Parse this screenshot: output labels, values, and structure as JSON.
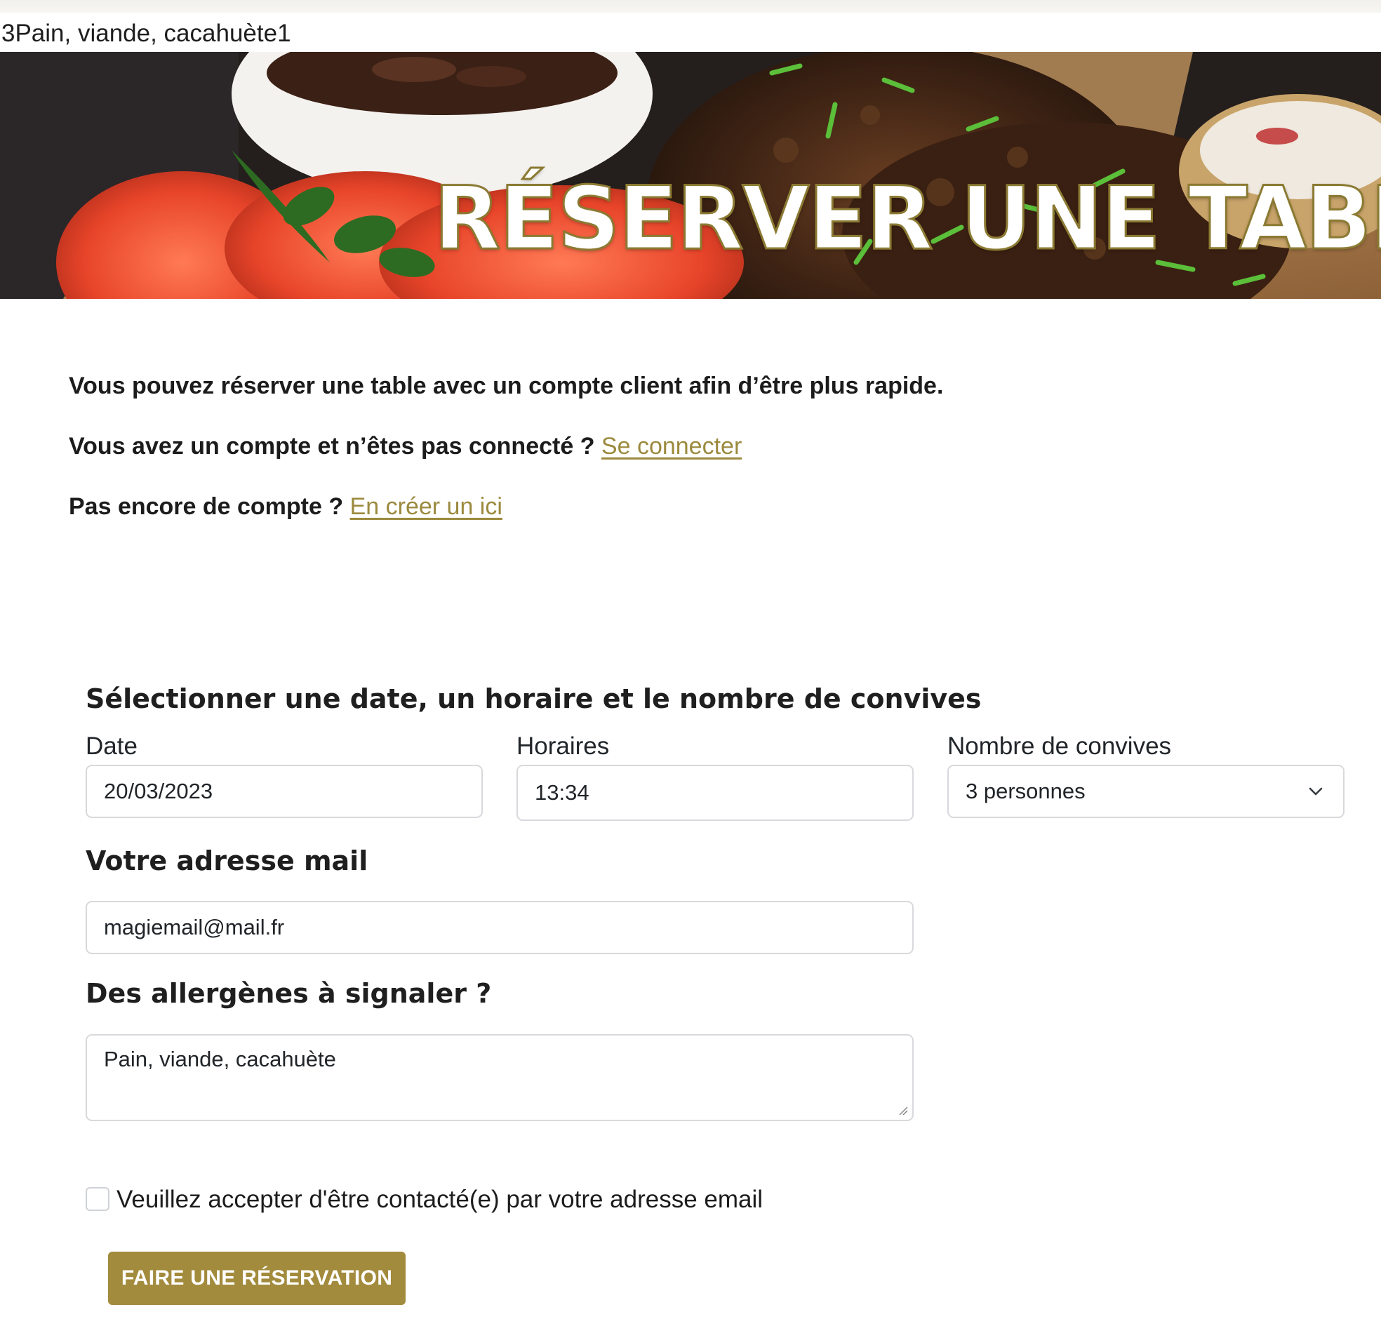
{
  "debug_output": "3Pain, viande, cacahuète1",
  "hero": {
    "title": "RÉSERVER UNE TABLE"
  },
  "intro": {
    "line1": "Vous pouvez réserver une table avec un compte client afin d’être plus rapide.",
    "line2_text": "Vous avez un compte et n’êtes pas connecté ?",
    "line2_link": "Se connecter",
    "line3_text": "Pas encore de compte ?",
    "line3_link": "En créer un ici"
  },
  "booking": {
    "heading": "Sélectionner une date, un horaire et le nombre de convives",
    "date_label": "Date",
    "date_value": "20/03/2023",
    "time_label": "Horaires",
    "time_value": "13:34",
    "guests_label": "Nombre de convives",
    "guests_selected": "3 personnes"
  },
  "email": {
    "heading": "Votre adresse mail",
    "value": "magiemail@mail.fr"
  },
  "allergens": {
    "heading": "Des allergènes à signaler ?",
    "value": "Pain, viande, cacahuète"
  },
  "consent": {
    "label": "Veuillez accepter d'être contacté(e) par votre adresse email",
    "checked": false
  },
  "submit": {
    "label": "FAIRE UNE RÉSERVATION"
  },
  "colors": {
    "accent": "#a38b3d",
    "link": "#9b8a3e",
    "title_outline": "#8b7a32"
  }
}
